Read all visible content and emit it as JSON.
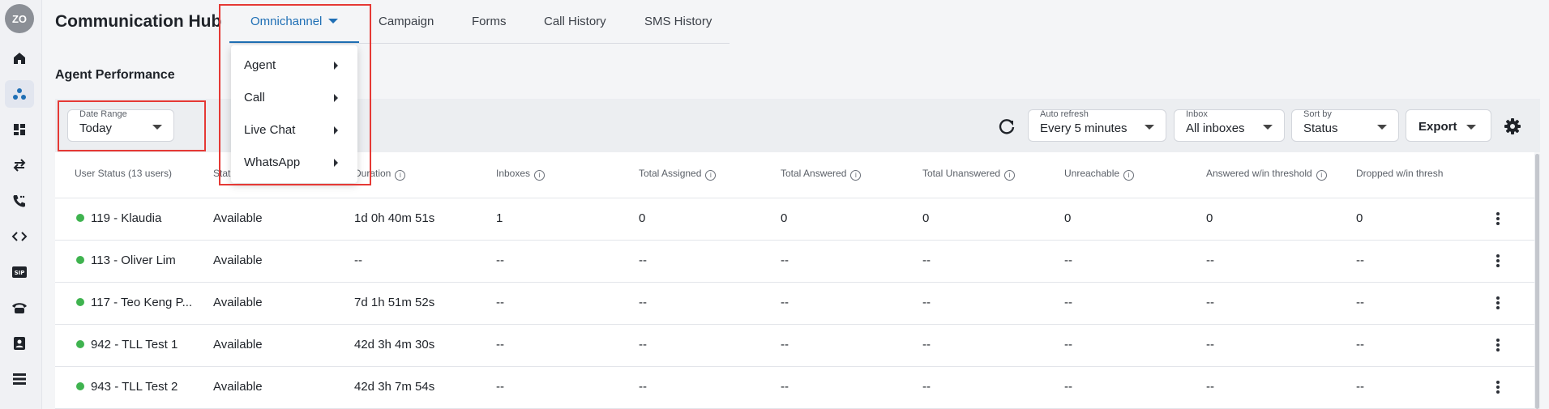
{
  "user": {
    "initials": "ZO"
  },
  "app": {
    "title": "Communication Hub"
  },
  "tabs": [
    {
      "label": "Omnichannel"
    },
    {
      "label": "Campaign"
    },
    {
      "label": "Forms"
    },
    {
      "label": "Call History"
    },
    {
      "label": "SMS History"
    }
  ],
  "menu": {
    "items": [
      {
        "label": "Agent"
      },
      {
        "label": "Call"
      },
      {
        "label": "Live Chat"
      },
      {
        "label": "WhatsApp"
      }
    ]
  },
  "section": {
    "title": "Agent Performance"
  },
  "filters": {
    "date_range": {
      "label": "Date Range",
      "value": "Today"
    },
    "auto_refresh": {
      "label": "Auto refresh",
      "value": "Every 5 minutes"
    },
    "inbox": {
      "label": "Inbox",
      "value": "All inboxes"
    },
    "sort_by": {
      "label": "Sort by",
      "value": "Status"
    },
    "export_label": "Export"
  },
  "table": {
    "columns": [
      "User Status (13 users)",
      "Status",
      "Duration",
      "Inboxes",
      "Total Assigned",
      "Total Answered",
      "Total Unanswered",
      "Unreachable",
      "Answered w/in threshold",
      "Dropped w/in thresh"
    ],
    "rows": [
      {
        "user": "119 - Klaudia",
        "status": "Available",
        "duration": "1d 0h 40m 51s",
        "inboxes": "1",
        "assigned": "0",
        "answered": "0",
        "unanswered": "0",
        "unreachable": "0",
        "answered_thr": "0",
        "dropped_thr": "0"
      },
      {
        "user": "113 - Oliver Lim",
        "status": "Available",
        "duration": "--",
        "inboxes": "--",
        "assigned": "--",
        "answered": "--",
        "unanswered": "--",
        "unreachable": "--",
        "answered_thr": "--",
        "dropped_thr": "--"
      },
      {
        "user": "117 - Teo Keng P...",
        "status": "Available",
        "duration": "7d 1h 51m 52s",
        "inboxes": "--",
        "assigned": "--",
        "answered": "--",
        "unanswered": "--",
        "unreachable": "--",
        "answered_thr": "--",
        "dropped_thr": "--"
      },
      {
        "user": "942 - TLL Test 1",
        "status": "Available",
        "duration": "42d 3h 4m 30s",
        "inboxes": "--",
        "assigned": "--",
        "answered": "--",
        "unanswered": "--",
        "unreachable": "--",
        "answered_thr": "--",
        "dropped_thr": "--"
      },
      {
        "user": "943 - TLL Test 2",
        "status": "Available",
        "duration": "42d 3h 7m 54s",
        "inboxes": "--",
        "assigned": "--",
        "answered": "--",
        "unanswered": "--",
        "unreachable": "--",
        "answered_thr": "--",
        "dropped_thr": "--"
      }
    ]
  },
  "colors": {
    "accent": "#1f6fb5",
    "available": "#3fb34f",
    "highlight": "#e53935"
  }
}
